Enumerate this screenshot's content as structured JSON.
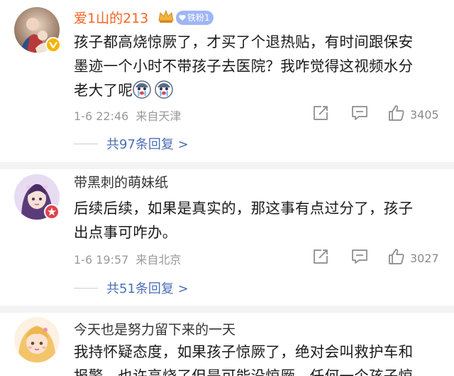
{
  "comments": [
    {
      "username": "爱1山的213",
      "fan_badge": "铁粉1",
      "text_lines": [
        "孩子都高烧惊厥了，才买了个退热贴，有时间跟保安",
        "墨迹一个小时不带孩子去医院？我咋觉得这视频水分",
        "老大了呢"
      ],
      "emojis": [
        "crying-face-icon",
        "crying-face-icon"
      ],
      "date": "1-6 22:46",
      "location": "来自天津",
      "likes": "3405",
      "replies": "共97条回复 >"
    },
    {
      "username": "带黑刺的萌妹纸",
      "text_lines": [
        "后续后续，如果是真实的，那这事有点过分了，孩子",
        "出点事可咋办。"
      ],
      "date": "1-6 19:57",
      "location": "来自北京",
      "likes": "3027",
      "replies": "共51条回复 >"
    },
    {
      "username": "今天也是努力留下来的一天",
      "text_lines": [
        "我持怀疑态度，如果孩子惊厥了，绝对会叫救护车和",
        "报警，也许高烧了但是可能没惊厥，任何一个孩子惊"
      ]
    }
  ],
  "colors": {
    "highlight_name": "#f26522",
    "reply_link": "#4b6fb5",
    "fan_badge": "#9fb6f5",
    "verified": "#f5b400"
  }
}
